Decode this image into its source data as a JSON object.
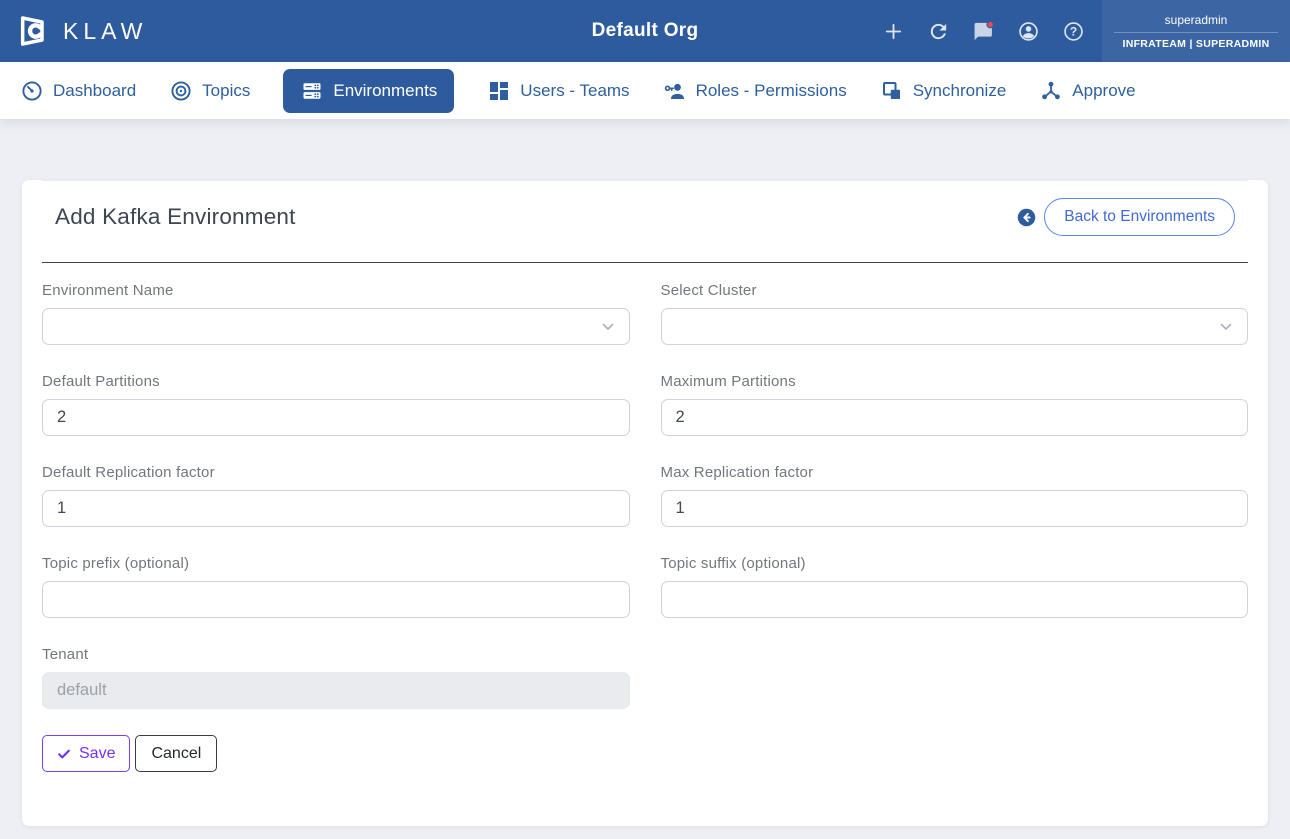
{
  "brand": {
    "name": "KLAW"
  },
  "header": {
    "title": "Default Org",
    "icon_names": [
      "add-icon",
      "refresh-icon",
      "messages-icon-with-red-badge",
      "profile-icon",
      "help-icon"
    ],
    "user": {
      "name": "superadmin",
      "team_role": "INFRATEAM | SUPERADMIN"
    }
  },
  "nav": {
    "items": [
      {
        "label": "Dashboard",
        "icon": "gauge-icon",
        "active": false
      },
      {
        "label": "Topics",
        "icon": "target-icon",
        "active": false
      },
      {
        "label": "Environments",
        "icon": "server-stack-icon",
        "active": true
      },
      {
        "label": "Users - Teams",
        "icon": "grid-icon",
        "active": false
      },
      {
        "label": "Roles - Permissions",
        "icon": "user-key-icon",
        "active": false
      },
      {
        "label": "Synchronize",
        "icon": "layers-icon",
        "active": false
      },
      {
        "label": "Approve",
        "icon": "hub-icon",
        "active": false
      }
    ]
  },
  "page": {
    "title": "Add Kafka Environment",
    "back_label": "Back to Environments"
  },
  "form": {
    "environment_name": {
      "label": "Environment Name",
      "value": ""
    },
    "select_cluster": {
      "label": "Select Cluster",
      "value": ""
    },
    "default_partitions": {
      "label": "Default Partitions",
      "value": "2"
    },
    "maximum_partitions": {
      "label": "Maximum Partitions",
      "value": "2"
    },
    "default_replication_factor": {
      "label": "Default Replication factor",
      "value": "1"
    },
    "max_replication_factor": {
      "label": "Max Replication factor",
      "value": "1"
    },
    "topic_prefix": {
      "label": "Topic prefix (optional)",
      "value": ""
    },
    "topic_suffix": {
      "label": "Topic suffix (optional)",
      "value": ""
    },
    "tenant": {
      "label": "Tenant",
      "placeholder": "default"
    },
    "save_label": "Save",
    "cancel_label": "Cancel"
  },
  "colors": {
    "header_blue": "#2e5b9d",
    "nav_blue": "#2e5f9e",
    "link_blue": "#3f6ad8",
    "accent_purple": "#7431f9",
    "notification_red": "#ee4757",
    "page_background": "#edeff4"
  }
}
